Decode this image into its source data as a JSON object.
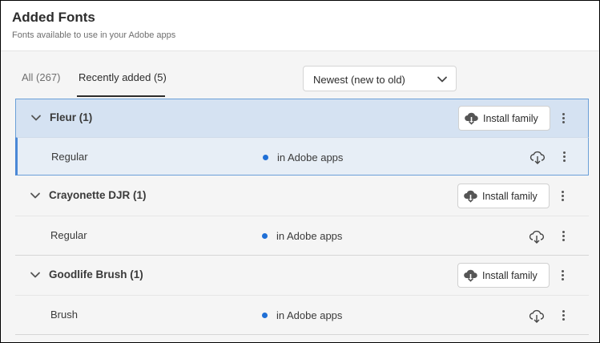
{
  "header": {
    "title": "Added Fonts",
    "subtitle": "Fonts available to use in your Adobe apps"
  },
  "tabs": [
    {
      "label": "All (267)",
      "active": false
    },
    {
      "label": "Recently added (5)",
      "active": true
    }
  ],
  "sort": {
    "selected": "Newest (new to old)",
    "icon": "chevron-down-icon"
  },
  "families": [
    {
      "name": "Fleur (1)",
      "install_label": "Install family",
      "selected": true,
      "styles": [
        {
          "name": "Regular",
          "status": "in Adobe apps"
        }
      ]
    },
    {
      "name": "Crayonette DJR (1)",
      "install_label": "Install family",
      "selected": false,
      "styles": [
        {
          "name": "Regular",
          "status": "in Adobe apps"
        }
      ]
    },
    {
      "name": "Goodlife Brush (1)",
      "install_label": "Install family",
      "selected": false,
      "styles": [
        {
          "name": "Brush",
          "status": "in Adobe apps"
        }
      ]
    }
  ],
  "colors": {
    "accent": "#1f6fd6",
    "selected_bg": "#d5e2f2",
    "selected_border": "#6a9fd8"
  }
}
